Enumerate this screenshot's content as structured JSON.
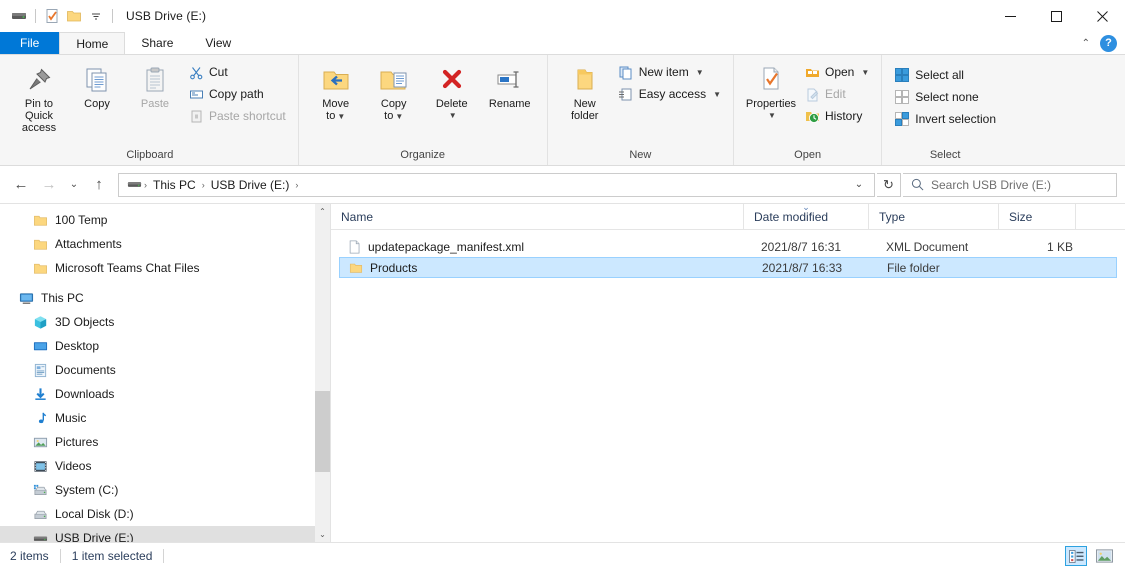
{
  "window": {
    "title": "USB Drive (E:)",
    "quick_access": [
      {
        "name": "drive-icon",
        "label": "USB Drive"
      },
      {
        "name": "properties-icon",
        "label": "Properties"
      },
      {
        "name": "new-folder-icon",
        "label": "New folder"
      },
      {
        "name": "customize-qat-icon",
        "label": "Customize Quick Access Toolbar"
      }
    ],
    "controls": {
      "minimize": "─",
      "maximize": "☐",
      "close": "✕"
    }
  },
  "tabs": [
    {
      "label": "File",
      "state": "file"
    },
    {
      "label": "Home",
      "state": "active"
    },
    {
      "label": "Share",
      "state": "normal"
    },
    {
      "label": "View",
      "state": "normal"
    }
  ],
  "tab_right": {
    "collapse_label": "⌃",
    "help_label": "?"
  },
  "ribbon": {
    "groups": [
      {
        "label": "Clipboard",
        "big": [
          {
            "label1": "Pin to Quick",
            "label2": "access",
            "icon": "pin-icon",
            "disabled": false
          },
          {
            "label1": "Copy",
            "label2": "",
            "icon": "copy-icon",
            "disabled": false
          },
          {
            "label1": "Paste",
            "label2": "",
            "icon": "paste-icon",
            "disabled": true
          }
        ],
        "small": [
          {
            "label": "Cut",
            "icon": "scissors-icon",
            "disabled": false,
            "caret": false
          },
          {
            "label": "Copy path",
            "icon": "copy-path-icon",
            "disabled": false,
            "caret": false
          },
          {
            "label": "Paste shortcut",
            "icon": "paste-shortcut-icon",
            "disabled": true,
            "caret": false
          }
        ]
      },
      {
        "label": "Organize",
        "big": [
          {
            "label1": "Move",
            "label2": "to",
            "icon": "move-to-icon",
            "disabled": false,
            "caret": true
          },
          {
            "label1": "Copy",
            "label2": "to",
            "icon": "copy-to-icon",
            "disabled": false,
            "caret": true
          },
          {
            "label1": "Delete",
            "label2": "",
            "icon": "delete-icon",
            "disabled": false,
            "caret": true
          },
          {
            "label1": "Rename",
            "label2": "",
            "icon": "rename-icon",
            "disabled": false,
            "caret": false
          }
        ],
        "small": []
      },
      {
        "label": "New",
        "big": [
          {
            "label1": "New",
            "label2": "folder",
            "icon": "new-folder-icon",
            "disabled": false
          }
        ],
        "small": [
          {
            "label": "New item",
            "icon": "new-item-icon",
            "disabled": false,
            "caret": true
          },
          {
            "label": "Easy access",
            "icon": "easy-access-icon",
            "disabled": false,
            "caret": true
          }
        ]
      },
      {
        "label": "Open",
        "big": [
          {
            "label1": "Properties",
            "label2": "",
            "icon": "properties-icon",
            "disabled": false,
            "caret": true
          }
        ],
        "small": [
          {
            "label": "Open",
            "icon": "open-icon",
            "disabled": false,
            "caret": true
          },
          {
            "label": "Edit",
            "icon": "edit-icon",
            "disabled": true,
            "caret": false
          },
          {
            "label": "History",
            "icon": "history-icon",
            "disabled": false,
            "caret": false
          }
        ]
      },
      {
        "label": "Select",
        "big": [],
        "small": [
          {
            "label": "Select all",
            "icon": "select-all-icon",
            "disabled": false,
            "caret": false
          },
          {
            "label": "Select none",
            "icon": "select-none-icon",
            "disabled": false,
            "caret": false
          },
          {
            "label": "Invert selection",
            "icon": "invert-selection-icon",
            "disabled": false,
            "caret": false
          }
        ]
      }
    ]
  },
  "addressbar": {
    "back": "←",
    "forward": "→",
    "recent": "⌄",
    "up": "↑",
    "breadcrumbs": [
      "This PC",
      "USB Drive (E:)"
    ],
    "separator": "›",
    "dropdown": "⌄",
    "refresh": "↻"
  },
  "search": {
    "placeholder": "Search USB Drive (E:)",
    "value": ""
  },
  "sidebar": {
    "items": [
      {
        "label": "100 Temp",
        "icon": "folder-icon",
        "indent": 1,
        "selected": false
      },
      {
        "label": "Attachments",
        "icon": "folder-icon",
        "indent": 1,
        "selected": false
      },
      {
        "label": "Microsoft Teams Chat Files",
        "icon": "folder-icon",
        "indent": 1,
        "selected": false
      },
      {
        "label": "This PC",
        "icon": "this-pc-icon",
        "indent": 0,
        "selected": false
      },
      {
        "label": "3D Objects",
        "icon": "3d-objects-icon",
        "indent": 2,
        "selected": false
      },
      {
        "label": "Desktop",
        "icon": "desktop-icon",
        "indent": 2,
        "selected": false
      },
      {
        "label": "Documents",
        "icon": "documents-icon",
        "indent": 2,
        "selected": false
      },
      {
        "label": "Downloads",
        "icon": "downloads-icon",
        "indent": 2,
        "selected": false
      },
      {
        "label": "Music",
        "icon": "music-icon",
        "indent": 2,
        "selected": false
      },
      {
        "label": "Pictures",
        "icon": "pictures-icon",
        "indent": 2,
        "selected": false
      },
      {
        "label": "Videos",
        "icon": "videos-icon",
        "indent": 2,
        "selected": false
      },
      {
        "label": "System (C:)",
        "icon": "system-drive-icon",
        "indent": 2,
        "selected": false
      },
      {
        "label": "Local Disk (D:)",
        "icon": "hard-drive-icon",
        "indent": 2,
        "selected": false
      },
      {
        "label": "USB Drive (E:)",
        "icon": "usb-drive-icon",
        "indent": 2,
        "selected": true
      }
    ],
    "scroll_up": "⌃",
    "scroll_down": "⌄"
  },
  "filelist": {
    "columns": [
      {
        "label": "Name",
        "sorted": false
      },
      {
        "label": "Date modified",
        "sorted": true,
        "sort_indicator": "⌄"
      },
      {
        "label": "Type",
        "sorted": false
      },
      {
        "label": "Size",
        "sorted": false
      }
    ],
    "rows": [
      {
        "name": "updatepackage_manifest.xml",
        "date": "2021/8/7 16:31",
        "type": "XML Document",
        "size": "1 KB",
        "icon": "xml-file-icon",
        "selected": false
      },
      {
        "name": "Products",
        "date": "2021/8/7 16:33",
        "type": "File folder",
        "size": "",
        "icon": "folder-icon",
        "selected": true
      }
    ]
  },
  "statusbar": {
    "item_count": "2 items",
    "selection": "1 item selected",
    "views": [
      {
        "name": "details-view-button",
        "active": true
      },
      {
        "name": "large-icons-view-button",
        "active": false
      }
    ]
  },
  "colors": {
    "accent": "#0078d7",
    "selection_fill": "#cce8ff",
    "selection_border": "#99d1ff",
    "ribbon_bg": "#f6f6f6",
    "folder_yellow": "#ffd882",
    "nav_selected": "#e0e0e0",
    "header_text": "#2b3e5c"
  }
}
